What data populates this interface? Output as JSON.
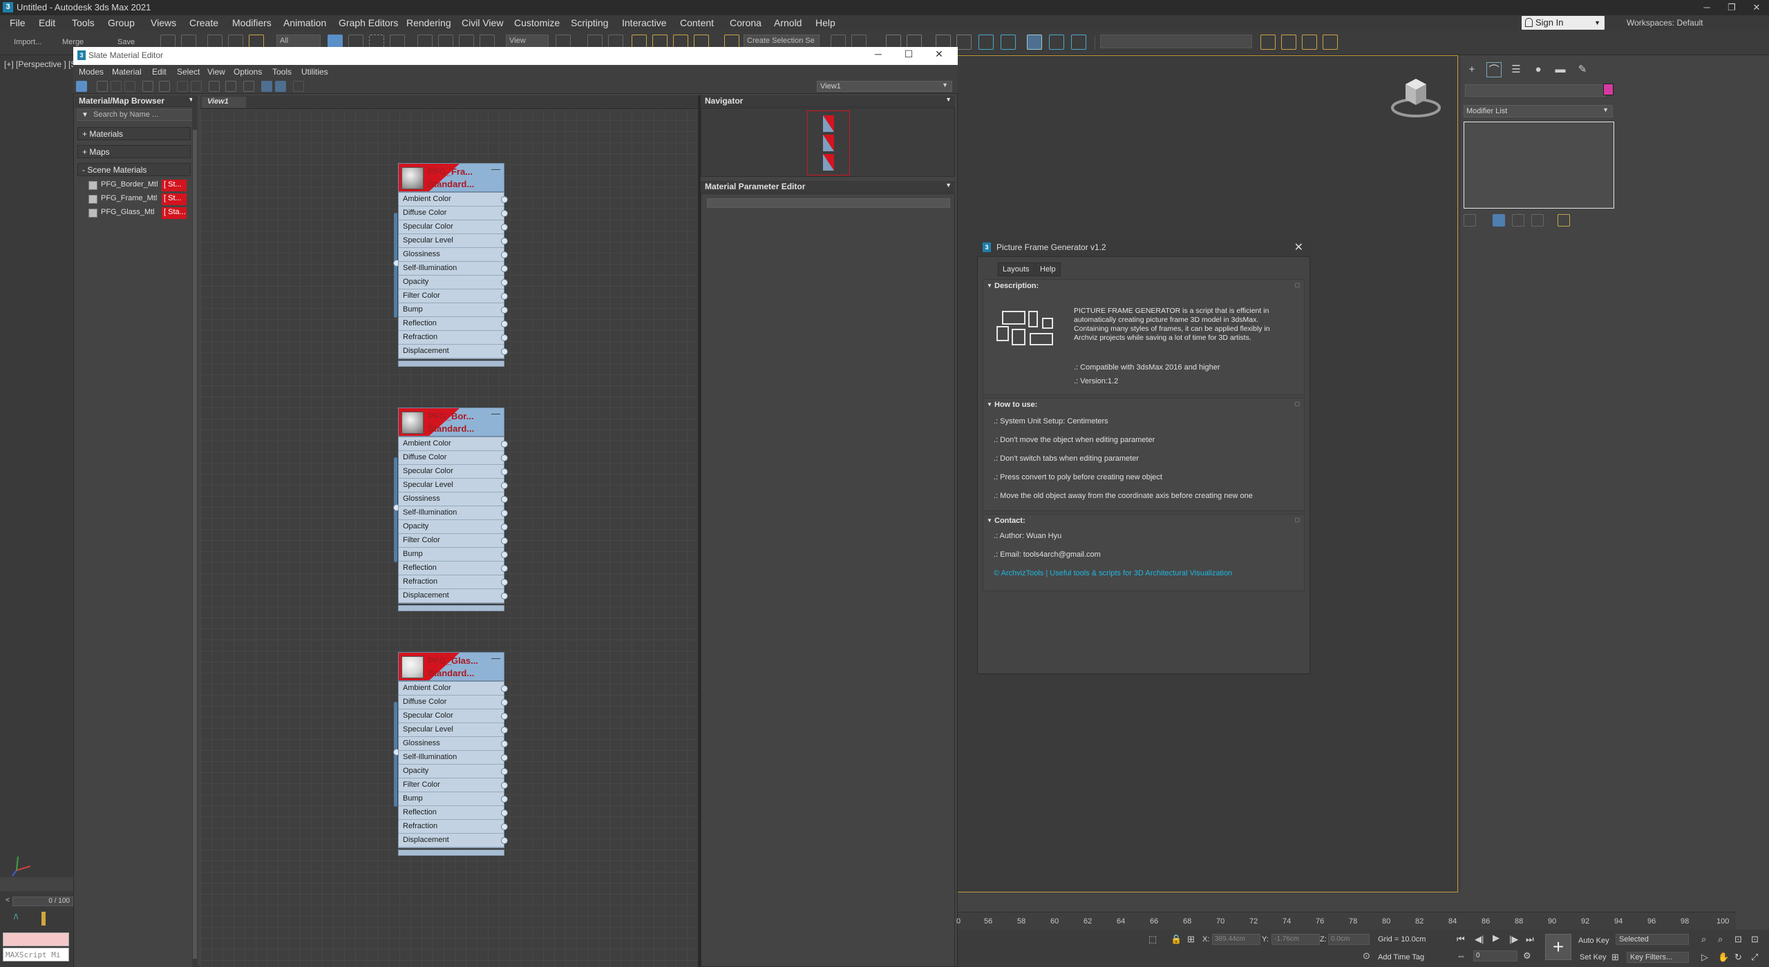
{
  "window": {
    "title": "Untitled - Autodesk 3ds Max 2021",
    "app_icon": "3"
  },
  "menubar": [
    "File",
    "Edit",
    "Tools",
    "Group",
    "Views",
    "Create",
    "Modifiers",
    "Animation",
    "Graph Editors",
    "Rendering",
    "Civil View",
    "Customize",
    "Scripting",
    "Interactive",
    "Content",
    "Corona",
    "Arnold",
    "Help"
  ],
  "signin": "Sign In",
  "workspaces": "Workspaces: Default",
  "toolbar": {
    "import": "Import...",
    "merge": "Merge",
    "save": "Save",
    "filter": "All",
    "ref_coord": "View",
    "named_selection": "Create Selection Se"
  },
  "viewport_label": "[+] [Perspective ] [S",
  "slate": {
    "title": "Slate Material Editor",
    "menu": [
      "Modes",
      "Material",
      "Edit",
      "Select",
      "View",
      "Options",
      "Tools",
      "Utilities"
    ],
    "view_dropdown": "View1",
    "browser_title": "Material/Map Browser",
    "search_placeholder": "Search by Name ...",
    "categories": [
      "+ Materials",
      "+ Maps",
      "- Scene Materials"
    ],
    "scene_materials": [
      {
        "name": "PFG_Border_Mtl",
        "tag": "[ St..."
      },
      {
        "name": "PFG_Frame_Mtl",
        "tag": "[ St..."
      },
      {
        "name": "PFG_Glass_Mtl",
        "tag": "[ Sta..."
      }
    ],
    "view_tab": "View1",
    "navigator_title": "Navigator",
    "mpe_title": "Material Parameter Editor",
    "nodes": [
      {
        "line1": "PFG_Fra...",
        "line2": "Standard...",
        "minimize": "—"
      },
      {
        "line1": "PFG_Bor...",
        "line2": "Standard...",
        "minimize": "—"
      },
      {
        "line1": "PFG_Glas...",
        "line2": "Standard...",
        "minimize": "—"
      }
    ],
    "slots": [
      "Ambient Color",
      "Diffuse Color",
      "Specular Color",
      "Specular Level",
      "Glossiness",
      "Self-Illumination",
      "Opacity",
      "Filter Color",
      "Bump",
      "Reflection",
      "Refraction",
      "Displacement"
    ]
  },
  "command_panel": {
    "modifier_list": "Modifier List",
    "object_color": "#d63aa0"
  },
  "pfg": {
    "title": "Picture Frame Generator v1.2",
    "tabs": [
      "Layouts",
      "Help"
    ],
    "description_header": "Description:",
    "description": "PICTURE FRAME GENERATOR  is a script that is efficient in automatically creating picture frame 3D model in 3dsMax. Containing many styles of frames, it can be applied flexibly in Archviz projects while saving a lot of time for 3D artists.",
    "compat": ".: Compatible with 3dsMax 2016 and higher",
    "version": ".: Version:1.2",
    "howto_header": "How to use:",
    "howto": [
      ".: System Unit Setup: Centimeters",
      ".: Don't move the object when editing parameter",
      ".: Don't switch tabs when editing parameter",
      ".: Press convert to poly before creating new object",
      ".: Move the old object away from the coordinate axis before creating new one"
    ],
    "contact_header": "Contact:",
    "author": ".: Author: Wuan Hyu",
    "email": ".: Email: tools4arch@gmail.com",
    "link": "© ArchvizTools | Useful tools & scripts for 3D Architectural Visualization"
  },
  "timeline": {
    "frame_counter": "0 / 100",
    "ticks": [
      "0",
      "56",
      "58",
      "60",
      "62",
      "64",
      "66",
      "68",
      "70",
      "72",
      "74",
      "76",
      "78",
      "80",
      "82",
      "84",
      "86",
      "88",
      "90",
      "92",
      "94",
      "96",
      "98",
      "100"
    ]
  },
  "status": {
    "x_label": "X:",
    "x_value": "389.44cm",
    "y_label": "Y:",
    "y_value": "-1.76cm",
    "z_label": "Z:",
    "z_value": "0.0cm",
    "grid": "Grid = 10.0cm",
    "add_time_tag": "Add Time Tag",
    "auto_key": "Auto Key",
    "selected": "Selected",
    "set_key": "Set Key",
    "key_filters": "Key Filters...",
    "frame_field": "0",
    "maxscript": "MAXScript Mi"
  },
  "colors": {
    "accent_red": "#d3141e",
    "node_blue": "#8fb3d5",
    "link_cyan": "#1fb8e0",
    "viewport_border": "#c19a3a"
  }
}
